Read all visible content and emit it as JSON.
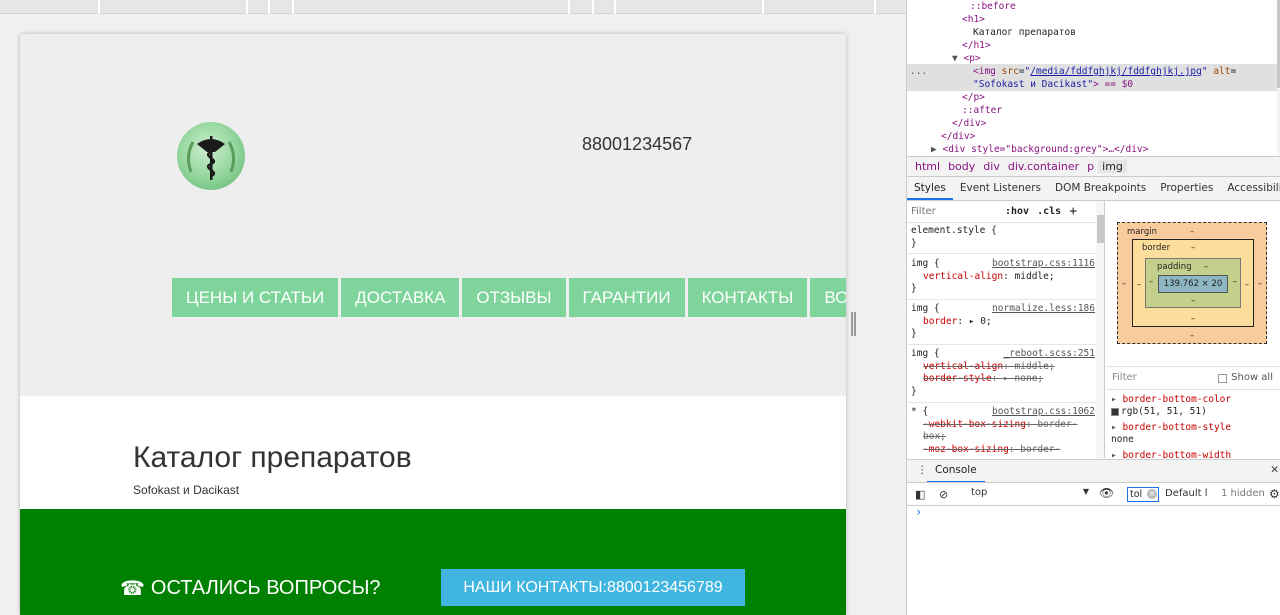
{
  "site": {
    "phone": "88001234567",
    "menu": [
      "ЦЕНЫ И СТАТЬИ",
      "ДОСТАВКА",
      "ОТЗЫВЫ",
      "ГАРАНТИИ",
      "КОНТАКТЫ",
      "ВО"
    ],
    "catalog_title": "Каталог препаратов",
    "broken_image_alt": "Sofokast и Dacikast",
    "footer": {
      "questions_label": "ОСТАЛИСЬ ВОПРОСЫ?",
      "contacts_label": "НАШИ КОНТАКТЫ:",
      "contacts_phone": "8800123456789"
    },
    "colors": {
      "header_bg": "#eeeeee",
      "menu_bg": "#7ed49a",
      "footer_bg": "#008000",
      "contacts_btn_bg": "#3fb5e0"
    }
  },
  "devtools": {
    "dom": {
      "before": "::before",
      "h1_open": "<h1>",
      "h1_text": "Каталог препаратов",
      "h1_close": "</h1>",
      "p_open": "<p>",
      "img_tag": "<img",
      "img_src_attr": "src",
      "img_src": "/media/fddfghjkj/fddfghjkj.jpg",
      "img_alt_attr": "alt",
      "img_alt": "\"Sofokast и Dacikast\"",
      "img_eq": "> == $0",
      "p_close": "</p>",
      "after": "::after",
      "div_close": "</div>",
      "div_close2": "</div>",
      "div_grey": "<div style=\"background:grey\">…</div>",
      "ellipsis": "..."
    },
    "breadcrumbs": [
      "html",
      "body",
      "div",
      "div.container",
      "p",
      "img"
    ],
    "tabs": [
      "Styles",
      "Event Listeners",
      "DOM Breakpoints",
      "Properties",
      "Accessibility"
    ],
    "styles": {
      "filter_placeholder": "Filter",
      "hov": ":hov",
      "cls": ".cls",
      "plus": "+",
      "rules": [
        {
          "selector": "element.style {",
          "close": "}",
          "source": "",
          "lines": []
        },
        {
          "selector": "img {",
          "close": "}",
          "source": "bootstrap.css:1116",
          "lines": [
            {
              "prop": "vertical-align",
              "value": "middle;",
              "struck": false
            }
          ]
        },
        {
          "selector": "img {",
          "close": "}",
          "source": "normalize.less:186",
          "lines": [
            {
              "prop": "border",
              "value": "▸ 0;",
              "struck": false
            }
          ]
        },
        {
          "selector": "img {",
          "close": "}",
          "source": "_reboot.scss:251",
          "lines": [
            {
              "prop": "vertical-align",
              "value": "middle;",
              "struck": true
            },
            {
              "prop": "border-style",
              "value": "▸ none;",
              "struck": true
            }
          ]
        },
        {
          "selector": "* {",
          "close": "",
          "source": "bootstrap.css:1062",
          "lines": [
            {
              "prop": "-webkit-box-sizing",
              "value": "border-box;",
              "struck": true
            },
            {
              "prop": "-moz-box-sizing",
              "value": "border-",
              "struck": true
            }
          ]
        }
      ]
    },
    "box_model": {
      "margin_label": "margin",
      "border_label": "border",
      "padding_label": "padding",
      "content_size": "139.762 × 20",
      "dash": "–"
    },
    "computed": {
      "filter_placeholder": "Filter",
      "show_all": "Show all",
      "props": [
        {
          "name": "border-bottom-color",
          "value": "rgb(51, 51, 51)",
          "swatch": "#333333"
        },
        {
          "name": "border-bottom-style",
          "value": "none"
        },
        {
          "name": "border-bottom-width",
          "value": ""
        }
      ]
    },
    "console": {
      "tab_label": "Console",
      "context": "top",
      "filter_value": "tol",
      "levels": "Default l",
      "hidden": "1 hidden",
      "prompt": "›"
    }
  }
}
